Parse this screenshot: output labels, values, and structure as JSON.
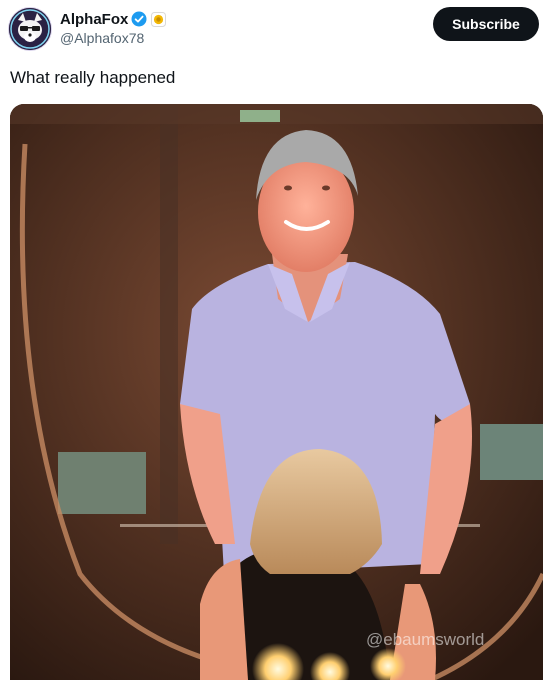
{
  "author": {
    "display_name": "AlphaFox",
    "handle": "@Alphafox78",
    "avatar_icon": "fox-avatar",
    "verified_icon": "verified-badge-icon",
    "affiliate_icon": "gold-badge-icon"
  },
  "actions": {
    "subscribe_label": "Subscribe"
  },
  "post": {
    "text": "What really happened"
  },
  "media": {
    "watermark": "@ebaumsworld",
    "colors": {
      "bg_dark": "#3a2418",
      "shirt": "#b9b3e0",
      "skin": "#f0a08a"
    }
  }
}
